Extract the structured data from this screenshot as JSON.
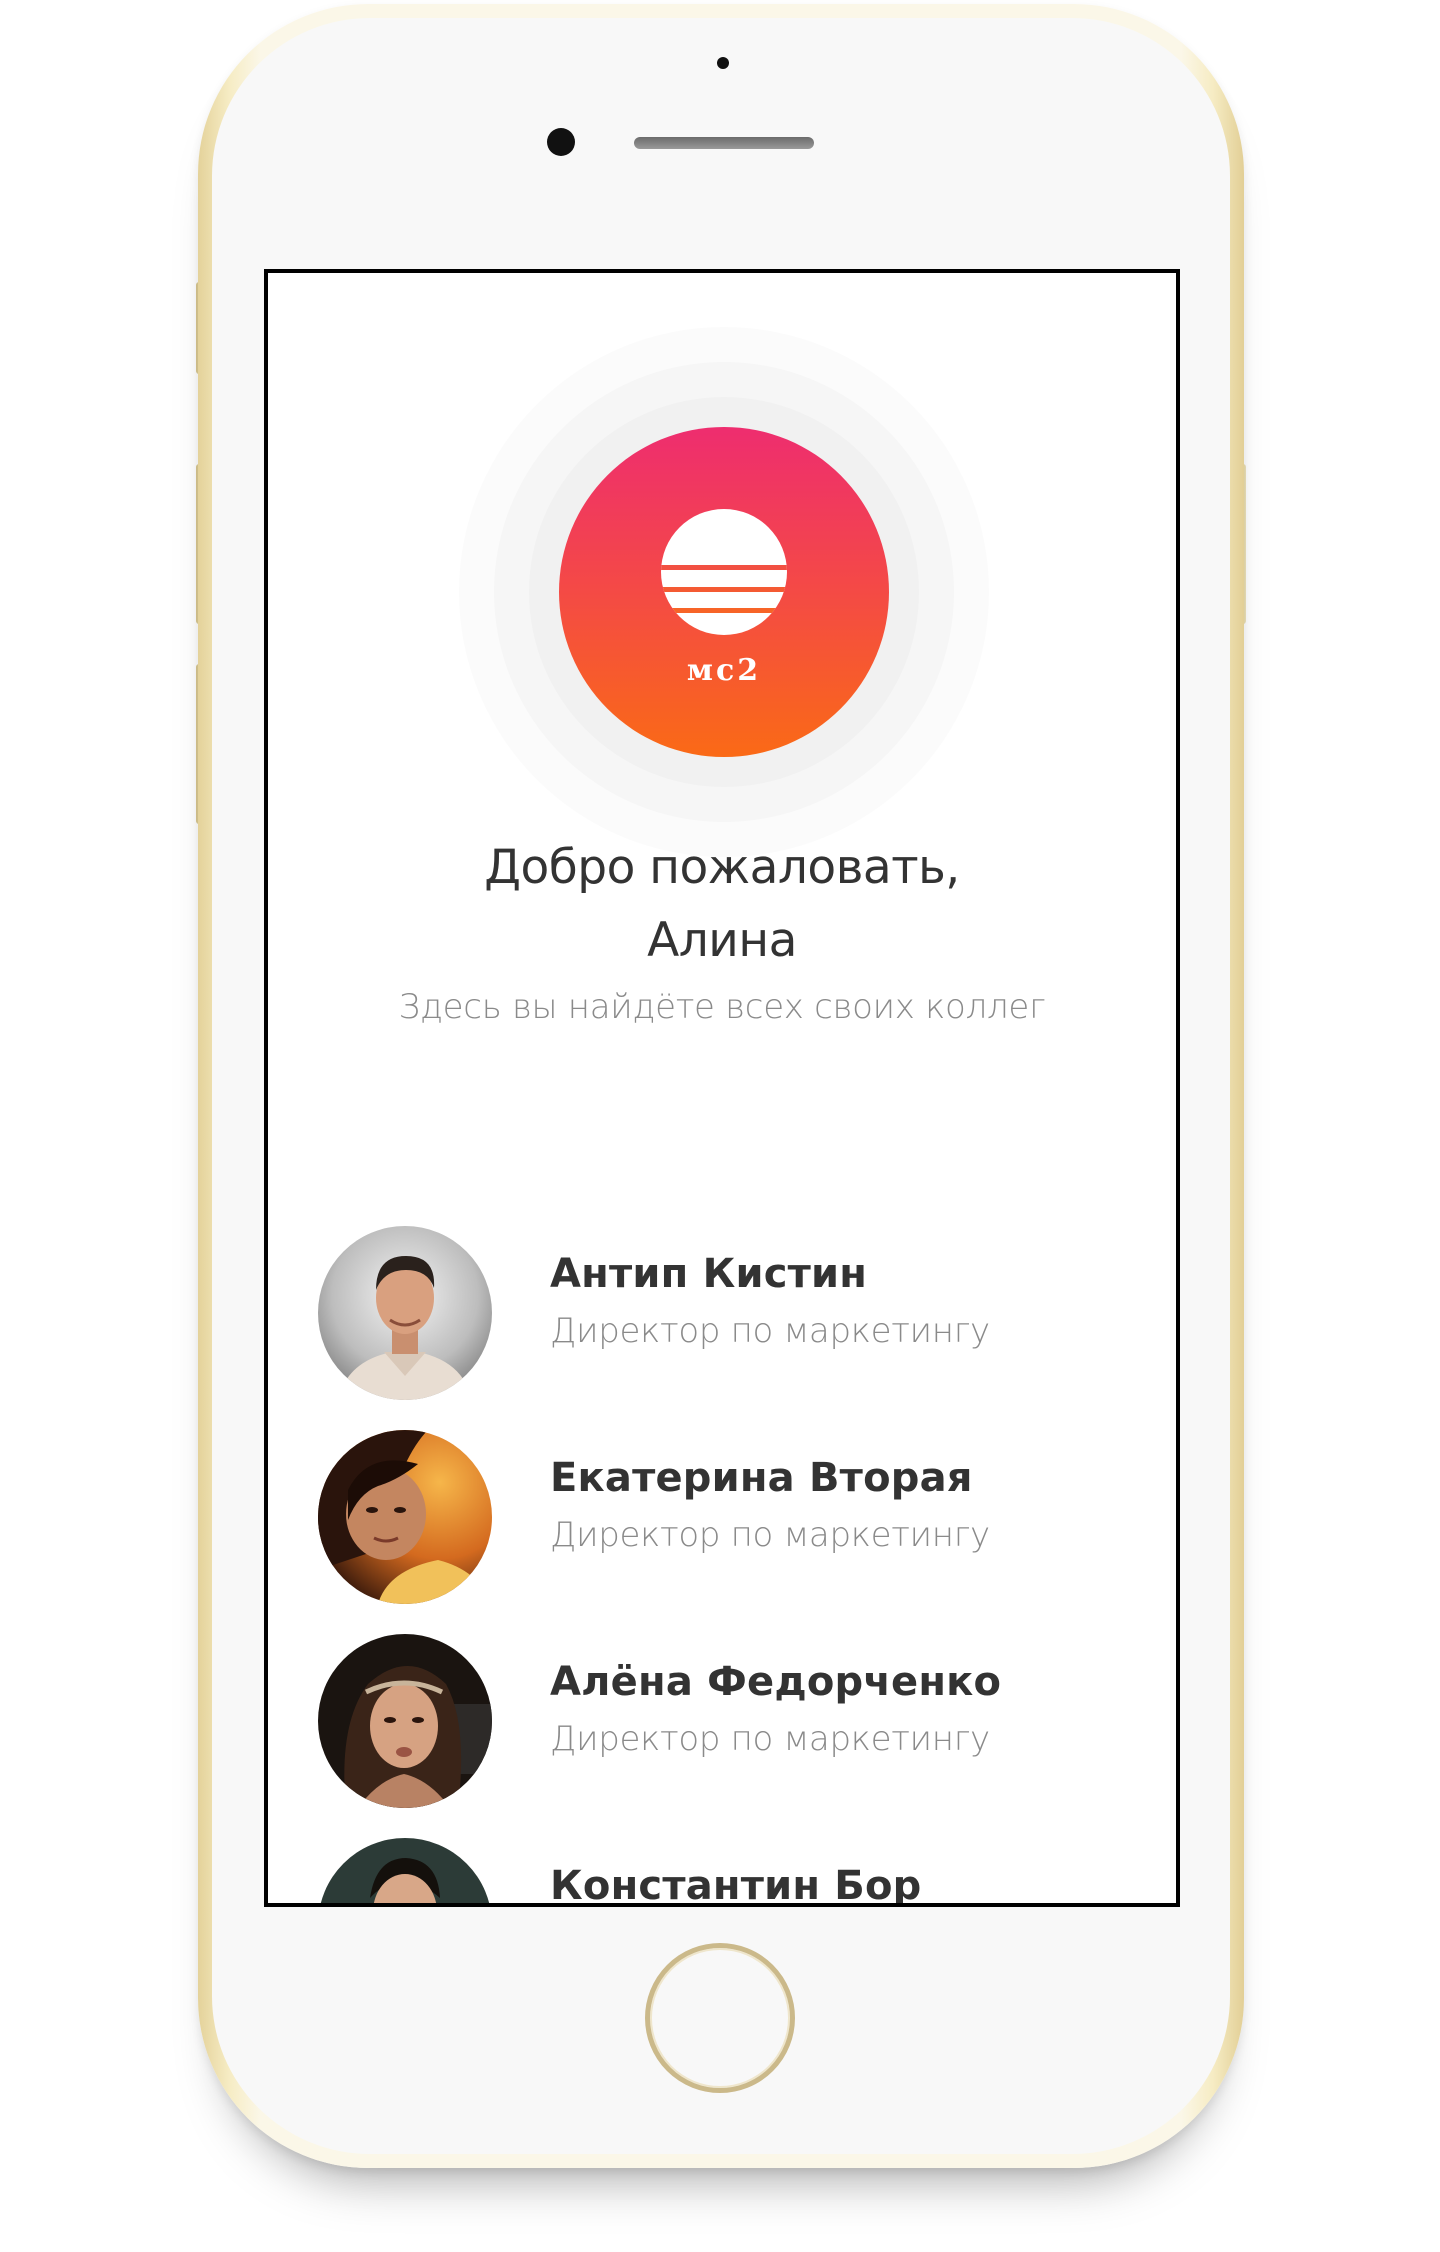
{
  "logo": {
    "icon": "mc2-logo-icon",
    "text": "мс2",
    "gradient_top": "#ee2d6f",
    "gradient_bottom": "#fa6a16"
  },
  "welcome": {
    "title_line1": "Добро пожаловать,",
    "title_line2": "Алина",
    "subtitle": "Здесь вы найдёте всех своих коллег"
  },
  "contacts": [
    {
      "name": "Антип Кистин",
      "role": "Директор по маркетингу",
      "avatar": "avatar-photo"
    },
    {
      "name": "Екатерина Вторая",
      "role": "Директор по маркетингу",
      "avatar": "avatar-photo"
    },
    {
      "name": "Алёна Федорченко",
      "role": "Директор по маркетингу",
      "avatar": "avatar-photo"
    },
    {
      "name": "Константин Бор",
      "role": "",
      "avatar": "avatar-photo"
    }
  ],
  "device": {
    "frame_color": "#f2e7c0",
    "screen_border_color": "#000000"
  }
}
